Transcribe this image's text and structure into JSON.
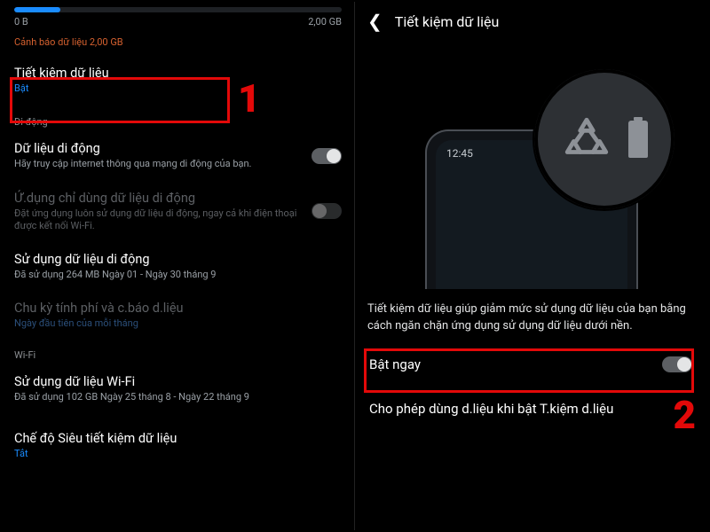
{
  "left": {
    "progress": {
      "start": "0 B",
      "end": "2,00 GB"
    },
    "warning": "Cảnh báo dữ liệu 2,00 GB",
    "data_saver": {
      "title": "Tiết kiệm dữ liệu",
      "state": "Bật"
    },
    "section_mobile": "Di động",
    "mobile_data": {
      "title": "Dữ liệu di động",
      "sub": "Hãy truy cập internet thông qua mạng di động của bạn."
    },
    "only_mobile": {
      "title": "Ứ.dụng chỉ dùng dữ liệu di động",
      "sub": "Đặt ứng dụng luôn sử dụng dữ liệu di động, ngay cả khi điện thoại được kết nối Wi-Fi."
    },
    "mobile_usage": {
      "title": "Sử dụng dữ liệu di động",
      "sub": "Đã sử dụng 264 MB Ngày 01 - Ngày 30 tháng 9"
    },
    "billing": {
      "title": "Chu kỳ tính phí và c.báo d.liệu",
      "sub": "Ngày đầu tiên của mỗi tháng"
    },
    "section_wifi": "Wi-Fi",
    "wifi_usage": {
      "title": "Sử dụng dữ liệu Wi-Fi",
      "sub": "Đã sử dụng 102 GB Ngày 25 tháng 8 - Ngày 22 tháng 9"
    },
    "ultra": {
      "title": "Chế độ Siêu tiết kiệm dữ liệu",
      "state": "Tắt"
    },
    "step": "1"
  },
  "right": {
    "title": "Tiết kiệm dữ liệu",
    "phone_time": "12:45",
    "description": "Tiết kiệm dữ liệu giúp giảm mức sử dụng dữ liệu của bạn bằng cách ngăn chặn ứng dụng sử dụng dữ liệu dưới nền.",
    "enable_now": "Bật ngay",
    "allow_while_saving": "Cho phép dùng d.liệu khi bật T.kiệm d.liệu",
    "step": "2"
  }
}
